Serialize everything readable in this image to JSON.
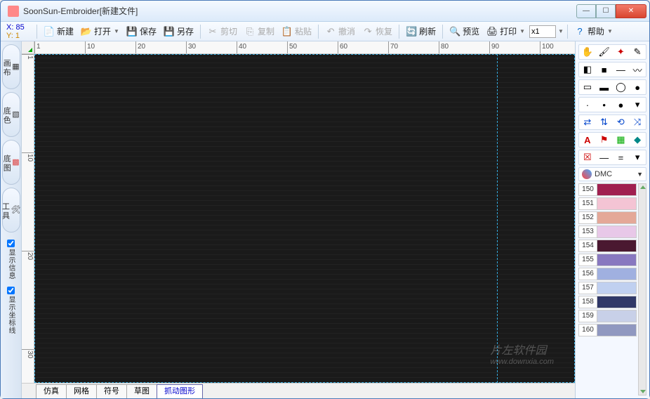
{
  "window": {
    "title": "SoonSun-Embroider[新建文件]"
  },
  "coords": {
    "x_label": "X:",
    "x_val": "85",
    "y_label": "Y:",
    "y_val": "1"
  },
  "toolbar": {
    "new": "新建",
    "open": "打开",
    "save": "保存",
    "saveas": "另存",
    "cut": "剪切",
    "copy": "复制",
    "paste": "粘贴",
    "undo": "撤消",
    "redo": "恢复",
    "refresh": "刷新",
    "preview": "预览",
    "print": "打印",
    "zoom": "x1",
    "help": "帮助"
  },
  "ruler_h": [
    "1",
    "10",
    "20",
    "30",
    "40",
    "50",
    "60",
    "70",
    "80",
    "90",
    "100"
  ],
  "ruler_v": [
    "1",
    "10",
    "20",
    "30"
  ],
  "left_tabs": [
    {
      "label": "画布"
    },
    {
      "label": "底色"
    },
    {
      "label": "底图"
    },
    {
      "label": "工具"
    }
  ],
  "left_checks": [
    "显示信息",
    "显示坐标线"
  ],
  "bottom_tabs": [
    {
      "label": "仿真",
      "active": false
    },
    {
      "label": "网格",
      "active": false
    },
    {
      "label": "符号",
      "active": false
    },
    {
      "label": "草图",
      "active": false
    },
    {
      "label": "抓动图形",
      "active": true
    }
  ],
  "palette": {
    "brand": "DMC",
    "items": [
      {
        "num": "150",
        "color": "#a02050"
      },
      {
        "num": "151",
        "color": "#f4c4d4"
      },
      {
        "num": "152",
        "color": "#e4a898"
      },
      {
        "num": "153",
        "color": "#e8c8e8"
      },
      {
        "num": "154",
        "color": "#4a1830"
      },
      {
        "num": "155",
        "color": "#8878c0"
      },
      {
        "num": "156",
        "color": "#a0b0e0"
      },
      {
        "num": "157",
        "color": "#c0d0f0"
      },
      {
        "num": "158",
        "color": "#303868"
      },
      {
        "num": "159",
        "color": "#c8d0e8"
      },
      {
        "num": "160",
        "color": "#9098c0"
      }
    ]
  },
  "watermark": {
    "main": "片左软件园",
    "sub": "www.downxia.com"
  }
}
